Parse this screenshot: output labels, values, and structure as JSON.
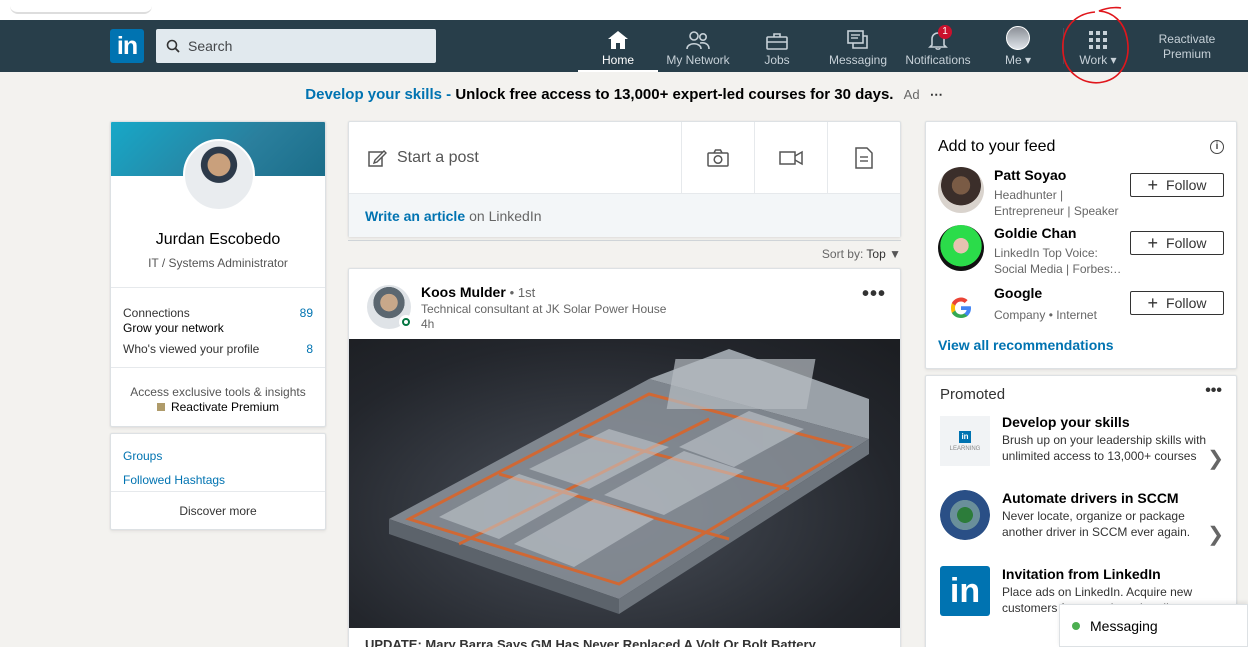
{
  "nav": {
    "search_placeholder": "Search",
    "items": [
      {
        "label": "Home",
        "icon": "home-icon"
      },
      {
        "label": "My Network",
        "icon": "people-icon"
      },
      {
        "label": "Jobs",
        "icon": "briefcase-icon"
      },
      {
        "label": "Messaging",
        "icon": "chat-icon"
      },
      {
        "label": "Notifications",
        "icon": "bell-icon",
        "badge": "1"
      },
      {
        "label": "Me",
        "icon": "avatar"
      },
      {
        "label": "Work",
        "icon": "grid-icon"
      }
    ],
    "reactivate_line1": "Reactivate",
    "reactivate_line2": "Premium"
  },
  "promo": {
    "highlight": "Develop your skills -",
    "text": "Unlock free access to 13,000+ expert-led courses for 30 days.",
    "ad_label": "Ad",
    "more": "⋯"
  },
  "profile": {
    "name": "Jurdan Escobedo",
    "title": "IT / Systems Administrator",
    "connections_label": "Connections",
    "connections_value": "89",
    "grow_label": "Grow your network",
    "viewed_label": "Who's viewed your profile",
    "viewed_value": "8",
    "access_text": "Access exclusive tools & insights",
    "premium_link": "Reactivate Premium"
  },
  "groups": {
    "groups_label": "Groups",
    "hashtags_label": "Followed Hashtags",
    "discover_label": "Discover more"
  },
  "share": {
    "start_post": "Start a post",
    "write_article": "Write an article",
    "on_linkedin": "on LinkedIn"
  },
  "sort": {
    "label": "Sort by:",
    "value": "Top"
  },
  "post": {
    "author": "Koos Mulder",
    "degree": "• 1st",
    "subtitle": "Technical consultant at JK Solar Power House",
    "time": "4h",
    "caption": "UPDATE: Mary Barra Says GM Has Never Replaced A Volt Or Bolt Battery"
  },
  "feed_suggestions": {
    "title": "Add to your feed",
    "items": [
      {
        "name": "Patt Soyao",
        "desc1": "Headhunter |",
        "desc2": "Entrepreneur | Speaker",
        "follow": "Follow"
      },
      {
        "name": "Goldie Chan",
        "desc1": "LinkedIn Top Voice:",
        "desc2": "Social Media | Forbes:…",
        "follow": "Follow"
      },
      {
        "name": "Google",
        "desc1": "Company • Internet",
        "desc2": "",
        "follow": "Follow"
      }
    ],
    "view_all": "View all recommendations"
  },
  "promoted": {
    "title": "Promoted",
    "items": [
      {
        "title": "Develop your skills",
        "desc": "Brush up on your leadership skills with unlimited access to 13,000+ courses"
      },
      {
        "title": "Automate drivers in SCCM",
        "desc": "Never locate, organize or package another driver in SCCM ever again."
      },
      {
        "title": "Invitation from LinkedIn",
        "desc": "Place ads on LinkedIn. Acquire new customers from a selected audience."
      }
    ]
  },
  "messaging": {
    "label": "Messaging"
  },
  "colors": {
    "nav_bg": "#283e4a",
    "brand_blue": "#0073b1",
    "badge_red": "#cb112d"
  }
}
